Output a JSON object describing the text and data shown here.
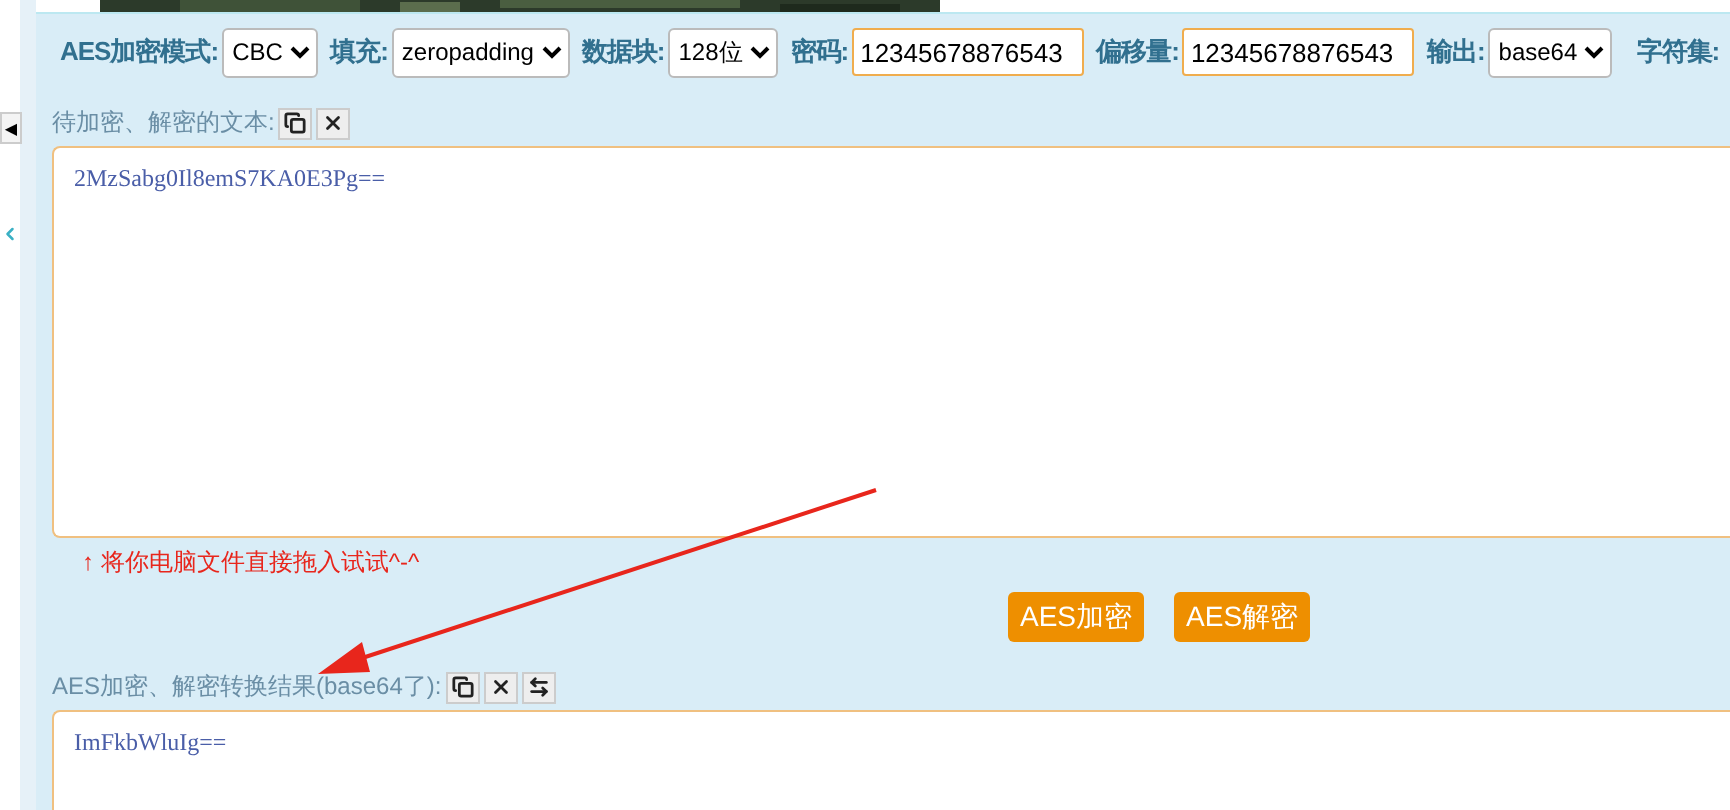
{
  "side_toggle": "◀",
  "toolbar": [
    {
      "kind": "select",
      "label": "AES加密模式:",
      "value": "CBC"
    },
    {
      "kind": "select",
      "label": "填充:",
      "value": "zeropadding"
    },
    {
      "kind": "select",
      "label": "数据块:",
      "value": "128位"
    },
    {
      "kind": "input",
      "label": "密码:",
      "value": "12345678876543"
    },
    {
      "kind": "input",
      "label": "偏移量:",
      "value": "12345678876543"
    },
    {
      "kind": "select",
      "label": "输出:",
      "value": "base64"
    },
    {
      "kind": "cut",
      "label": "字符集:"
    }
  ],
  "input_section": {
    "label": "待加密、解密的文本:",
    "tools": [
      {
        "kind": "copy"
      },
      {
        "kind": "clear"
      }
    ],
    "text": "2MzSabg0Il8emS7KA0E3Pg==",
    "hint": "↑ 将你电脑文件直接拖入试试^-^"
  },
  "buttons": [
    "AES加密",
    "AES解密"
  ],
  "output_section": {
    "label": "AES加密、解密转换结果(base64了):",
    "tools": [
      {
        "kind": "copy"
      },
      {
        "kind": "clear"
      },
      {
        "kind": "swap"
      }
    ],
    "text": "ImFkbWluIg=="
  }
}
